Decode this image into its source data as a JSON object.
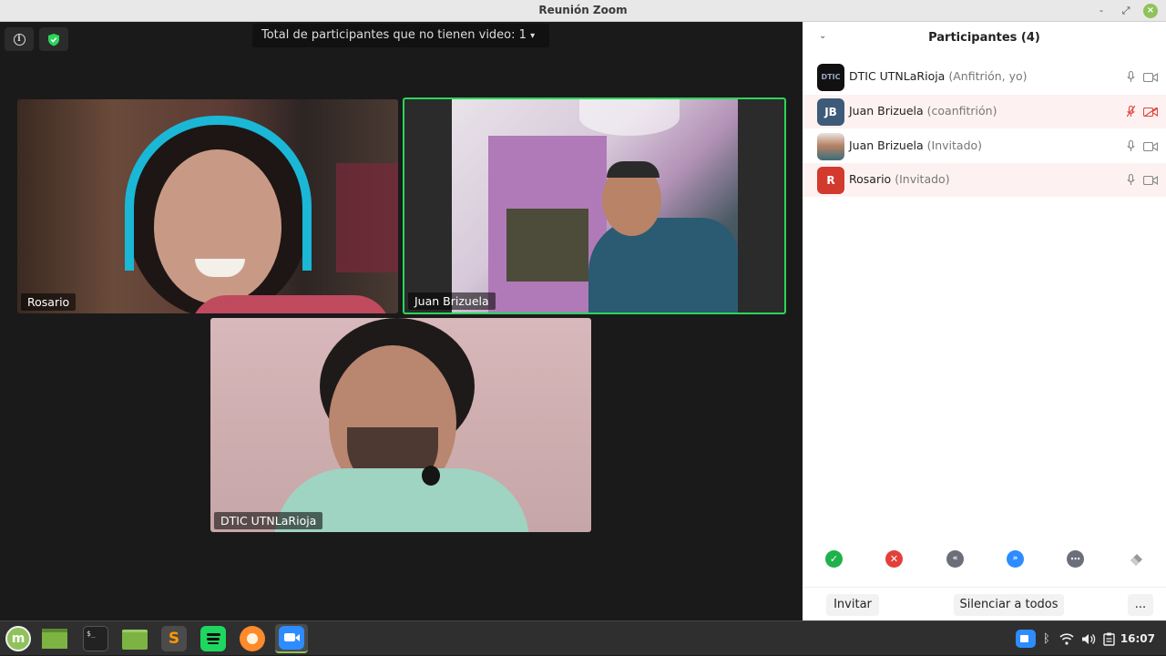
{
  "window": {
    "title": "Reunión Zoom",
    "minimize": "-",
    "maximize": "⤢",
    "close": "×"
  },
  "video_area": {
    "info_icon": "i",
    "no_video_banner": "Total de participantes que no tienen video: 1",
    "banner_arrow": "▾",
    "tiles": [
      {
        "name": "Rosario"
      },
      {
        "name": "Juan Brizuela"
      },
      {
        "name": "DTIC UTNLaRioja"
      }
    ],
    "active_speaker_color": "#2bd65a"
  },
  "panel": {
    "collapse_icon": "⌄",
    "title": "Participantes (4)",
    "participants": [
      {
        "avatar": "DTIC",
        "name": "DTIC UTNLaRioja",
        "role": "(Anfitrión, yo)",
        "muted": false,
        "video_off": false
      },
      {
        "avatar": "JB",
        "name": "Juan Brizuela",
        "role": "(coanfitrión)",
        "muted": true,
        "video_off": true
      },
      {
        "avatar": "",
        "name": "Juan Brizuela",
        "role": "(Invitado)",
        "muted": false,
        "video_off": false
      },
      {
        "avatar": "R",
        "name": "Rosario",
        "role": "(Invitado)",
        "muted": false,
        "video_off": false
      }
    ],
    "action_icons": [
      "check-icon",
      "cross-icon",
      "rewind-icon",
      "fast-forward-icon",
      "more-icon",
      "eraser-icon"
    ],
    "footer": {
      "invite": "Invitar",
      "mute_all": "Silenciar a todos",
      "more": "..."
    }
  },
  "taskbar": {
    "apps": [
      "mint-menu-icon",
      "show-desktop-icon",
      "terminal-icon",
      "files-icon",
      "sublime-text-icon",
      "spotify-icon",
      "firefox-icon",
      "zoom-icon"
    ],
    "terminal_glyph": "$_",
    "sublime_glyph": "S",
    "clock": "16:07"
  }
}
